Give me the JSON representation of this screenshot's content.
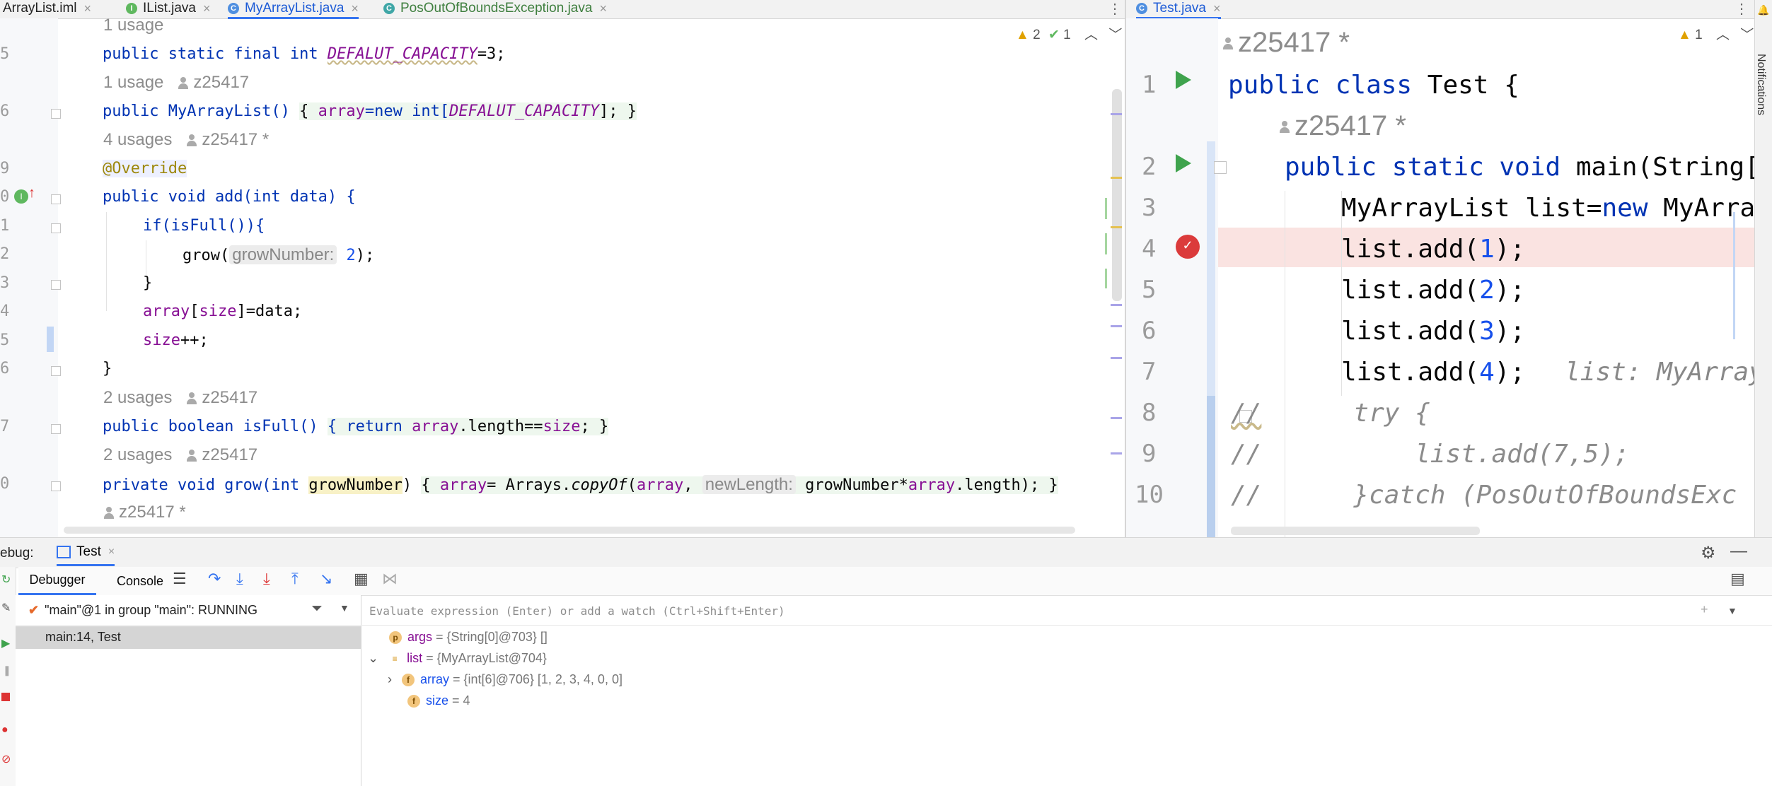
{
  "left_tabs": [
    {
      "label": "ArrayList.iml",
      "active": false
    },
    {
      "label": "IList.java",
      "active": false
    },
    {
      "label": "MyArrayList.java",
      "active": true
    },
    {
      "label": "PosOutOfBoundsException.java",
      "active": false
    }
  ],
  "right_tabs": [
    {
      "label": "Test.java",
      "active": true
    }
  ],
  "left_editor": {
    "inspection": {
      "warnings": "2",
      "weak": "1"
    },
    "line_numbers": [
      "5",
      "6",
      "9",
      "0",
      "1",
      "2",
      "3",
      "4",
      "5",
      "6",
      "7",
      "0"
    ],
    "usages": [
      {
        "count": "1 usage",
        "author": ""
      },
      {
        "count": "1 usage",
        "author": "z25417"
      },
      {
        "count": "4 usages",
        "author": "z25417 *"
      },
      {
        "count": "2 usages",
        "author": "z25417"
      },
      {
        "count": "2 usages",
        "author": "z25417"
      },
      {
        "count": "",
        "author": "z25417 *"
      }
    ],
    "code": {
      "l5_a": "public static final int ",
      "l5_const": "DEFALUT_CAPACITY",
      "l5_b": "=3;",
      "l6_a": "public MyArrayList() ",
      "l6_b": "{ ",
      "l6_c": "array",
      "l6_d": "=new int[",
      "l6_e": "DEFALUT_CAPACITY",
      "l6_f": "]; }",
      "l9": "@Override",
      "l10": "public void add(int data) {",
      "l11": "if(isFull()){",
      "l12_a": "grow(",
      "l12_hint": "growNumber:",
      "l12_b": " 2",
      "l12_c": ");",
      "l13": "}",
      "l14_a": "array",
      "l14_b": "[",
      "l14_c": "size",
      "l14_d": "]=data;",
      "l15_a": "size",
      "l15_b": "++;",
      "l16": "}",
      "l17_a": "public boolean isFull() ",
      "l17_b": "{ return ",
      "l17_c": "array",
      "l17_d": ".length==",
      "l17_e": "size",
      "l17_f": "; }",
      "l20_a": "private void grow(int ",
      "l20_param": "growNumber",
      "l20_b": ") ",
      "l20_c": "{ ",
      "l20_d": "array",
      "l20_e": "= Arrays.",
      "l20_f": "copyOf",
      "l20_g": "(",
      "l20_h": "array",
      "l20_i": ", ",
      "l20_hint": "newLength:",
      "l20_j": " growNumber*",
      "l20_k": "array",
      "l20_l": ".length); }"
    }
  },
  "right_editor": {
    "inspection": {
      "weak": "1"
    },
    "author_top": "z25417 *",
    "author_main": "z25417 *",
    "lines": [
      {
        "n": "1",
        "text": "public class Test {"
      },
      {
        "n": "2",
        "text": "public static void main(String[]"
      },
      {
        "n": "3",
        "text": "MyArrayList list=new MyArrayL"
      },
      {
        "n": "4",
        "text": "list.add(1);"
      },
      {
        "n": "5",
        "text": "list.add(2);"
      },
      {
        "n": "6",
        "text": "list.add(3);"
      },
      {
        "n": "7",
        "text": "list.add(4);"
      },
      {
        "n": "8",
        "text": "try {"
      },
      {
        "n": "9",
        "text": "list.add(7,5);"
      },
      {
        "n": "10",
        "text": "}catch (PosOutOfBoundsExc"
      }
    ],
    "line7_hint": "list: MyArrayL",
    "comment_prefix": "//"
  },
  "notifications_label": "Notifications",
  "debug": {
    "title": "ebug:",
    "session_tab": "Test",
    "tabs": [
      "Debugger",
      "Console"
    ],
    "thread": "\"main\"@1 in group \"main\": RUNNING",
    "frame": "main:14, Test",
    "eval_placeholder": "Evaluate expression (Enter) or add a watch (Ctrl+Shift+Enter)",
    "variables": [
      {
        "badge": "p",
        "name": "args",
        "value": " = {String[0]@703} []"
      },
      {
        "badge": "≡",
        "name": "list",
        "value": " = {MyArrayList@704}"
      },
      {
        "badge": "f",
        "name": "array",
        "value": " = {int[6]@706} [1, 2, 3, 4, 0, 0]"
      },
      {
        "badge": "f",
        "name": "size",
        "value": " = 4"
      }
    ]
  },
  "colors": {
    "keyword": "#0033b3",
    "field": "#871094",
    "number": "#1750eb",
    "annotation": "#9e880d",
    "breakpoint_line": "#fae3e1",
    "accent": "#3574f0"
  }
}
